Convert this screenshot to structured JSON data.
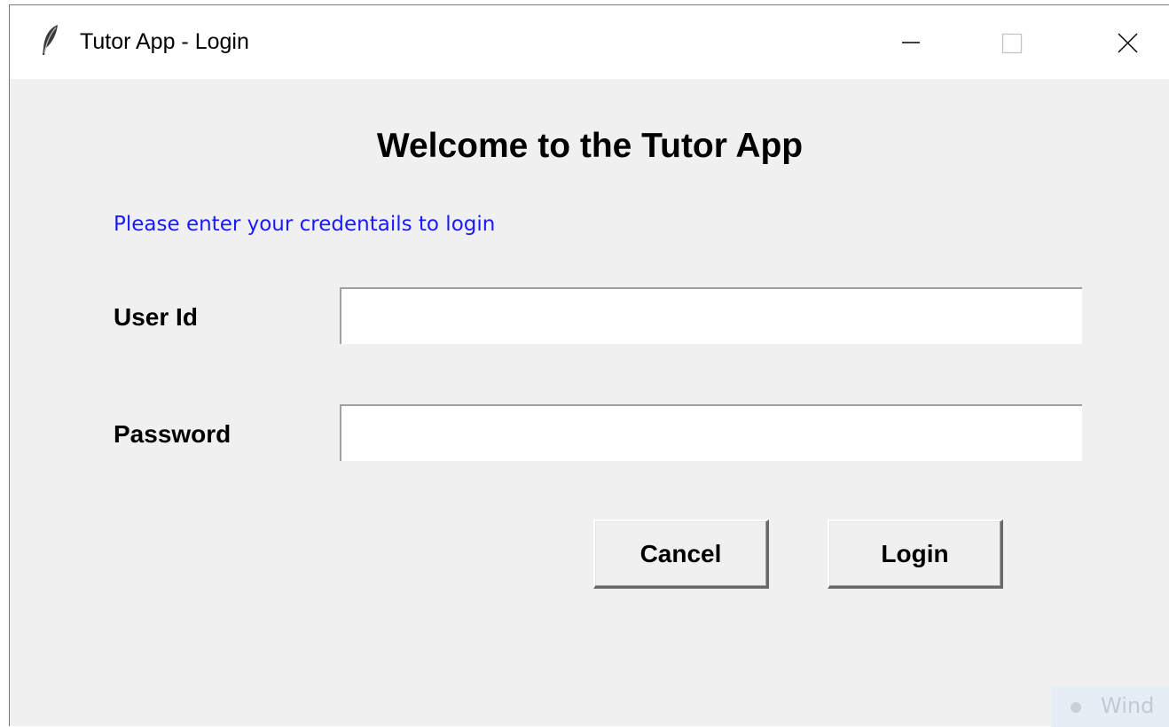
{
  "window": {
    "title": "Tutor App - Login",
    "app_icon": "feather-icon",
    "controls": {
      "minimize": "minimize-icon",
      "maximize": "maximize-icon",
      "close": "close-icon"
    }
  },
  "main": {
    "heading": "Welcome to the Tutor App",
    "subtitle": "Please enter your credentails to login",
    "subtitle_color": "#1a1aff",
    "fields": {
      "user_id": {
        "label": "User Id",
        "value": ""
      },
      "password": {
        "label": "Password",
        "value": ""
      }
    },
    "buttons": {
      "cancel": "Cancel",
      "login": "Login"
    }
  },
  "overlay": {
    "watermark_text": "Wind"
  },
  "colors": {
    "background": "#f0f0f0",
    "titlebar": "#ffffff",
    "entry_background": "#ffffff"
  }
}
